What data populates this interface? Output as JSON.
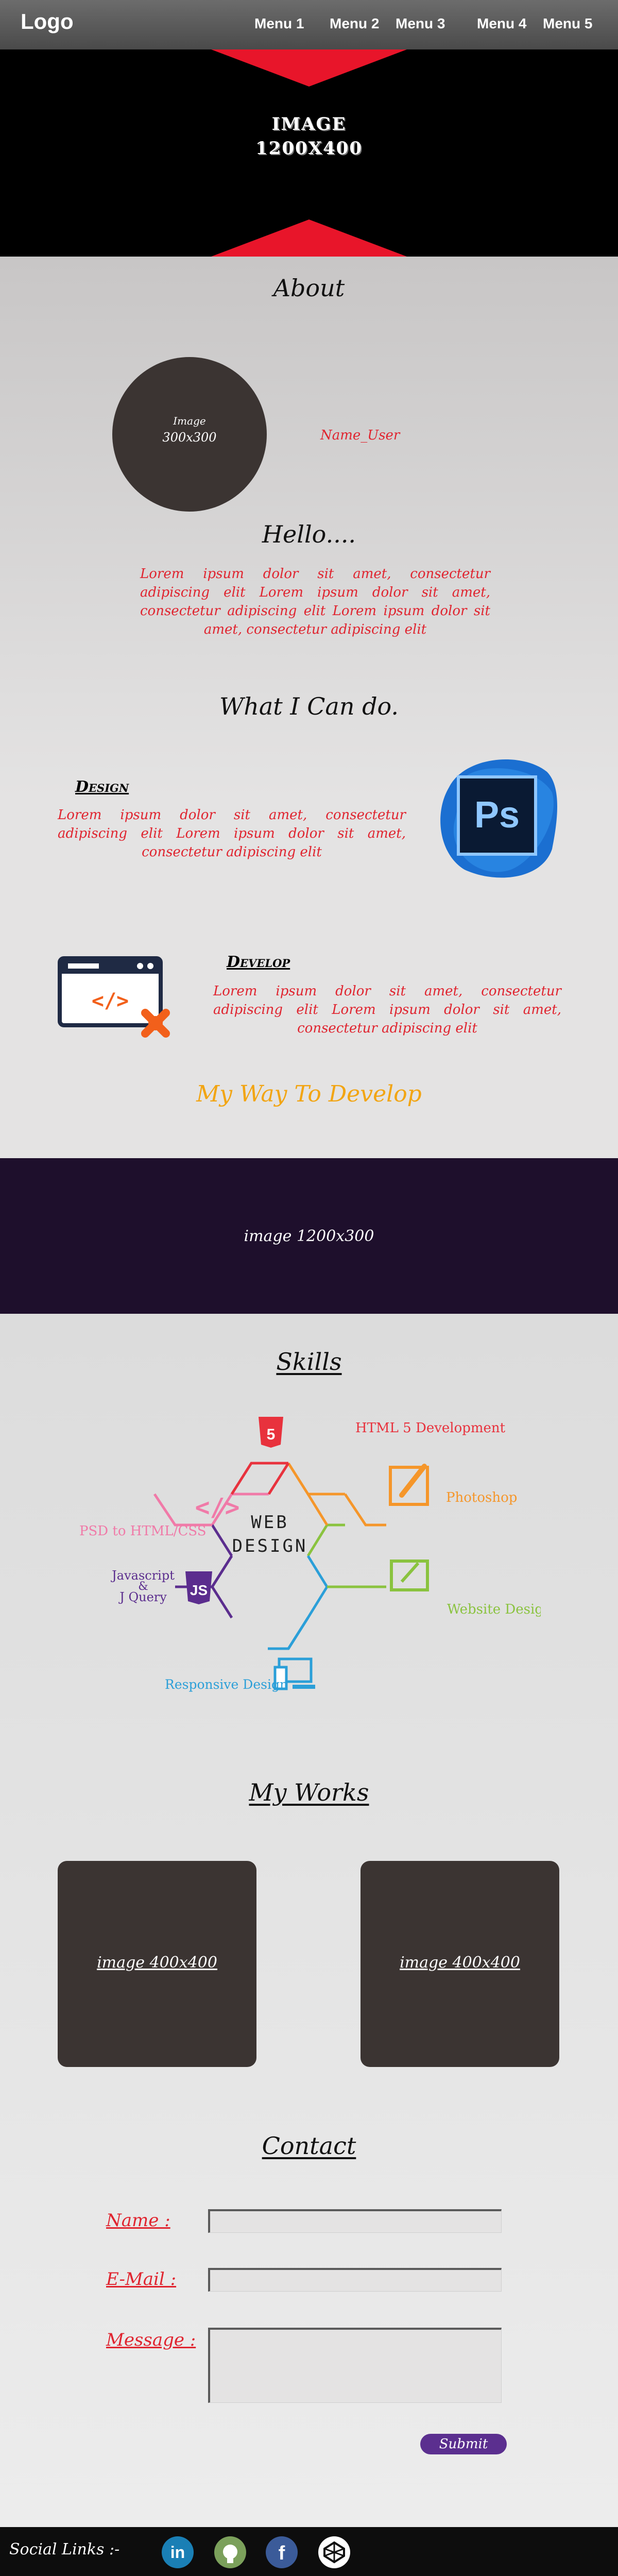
{
  "nav": {
    "logo": "Logo",
    "menus": [
      "Menu 1",
      "Menu 2",
      "Menu 3",
      "Menu 4",
      "Menu 5"
    ]
  },
  "hero": {
    "line1": "IMAGE",
    "line2": "1200X400"
  },
  "about": {
    "title": "About",
    "image_line1": "Image",
    "image_line2": "300x300",
    "name": "Name_User",
    "hello": "Hello....",
    "bio": "Lorem ipsum dolor sit amet, consectetur adipiscing elit Lorem ipsum dolor sit amet, consectetur adipiscing elit Lorem ipsum dolor sit amet, consectetur adipiscing elit"
  },
  "services": {
    "title": "What I Can do.",
    "design": {
      "heading": "Design",
      "text": "Lorem ipsum dolor sit amet, consectetur adipiscing elit Lorem ipsum dolor sit amet, consectetur adipiscing elit",
      "icon_text": "Ps"
    },
    "develop": {
      "heading": "Develop",
      "text": "Lorem ipsum dolor sit amet, consectetur adipiscing elit Lorem ipsum dolor sit amet, consectetur adipiscing elit",
      "icon_text": "</>"
    },
    "tagline": "My Way To Develop"
  },
  "banner": {
    "text": "image 1200x300"
  },
  "skills": {
    "title": "Skills",
    "center_line1": "WEB",
    "center_line2": "DESIGN",
    "items": [
      {
        "label": "HTML 5 Development",
        "color": "#e8323d",
        "icon_text": "5"
      },
      {
        "label": "Photoshop",
        "color": "#f5962a",
        "icon_text": ""
      },
      {
        "label": "Website Design",
        "color": "#8ac33f",
        "icon_text": ""
      },
      {
        "label": "Responsive Design",
        "color": "#2b9fd8",
        "icon_text": ""
      },
      {
        "label": "Javascript",
        "label2": "&",
        "label3": "J Query",
        "color": "#5b2d8e",
        "icon_text": "JS"
      },
      {
        "label": "PSD to HTML/CSS",
        "color": "#f07aa8",
        "icon_text": "</>"
      }
    ]
  },
  "works": {
    "title": "My Works",
    "items": [
      "image 400x400",
      "image 400x400"
    ]
  },
  "contact": {
    "title": "Contact",
    "name_label": "Name :",
    "email_label": "E-Mail :",
    "message_label": "Message :",
    "submit_label": "Submit"
  },
  "footer": {
    "social_label": "Social Links :-",
    "links": [
      {
        "icon": "linkedin-icon",
        "text": "in",
        "color": "#1a7fb5"
      },
      {
        "icon": "github-icon",
        "text": "",
        "color": "#7ba05b"
      },
      {
        "icon": "facebook-icon",
        "text": "f",
        "color": "#3b5b99"
      },
      {
        "icon": "codepen-icon",
        "text": "",
        "color": "#ffffff"
      }
    ]
  },
  "colors": {
    "accent_red": "#e0242f",
    "nav_bg": "#5c5c5c",
    "banner_bg": "#1e0f2c",
    "dark_box": "#3b3432",
    "orange": "#f2a513",
    "submit_purple": "#5b2f8f"
  }
}
